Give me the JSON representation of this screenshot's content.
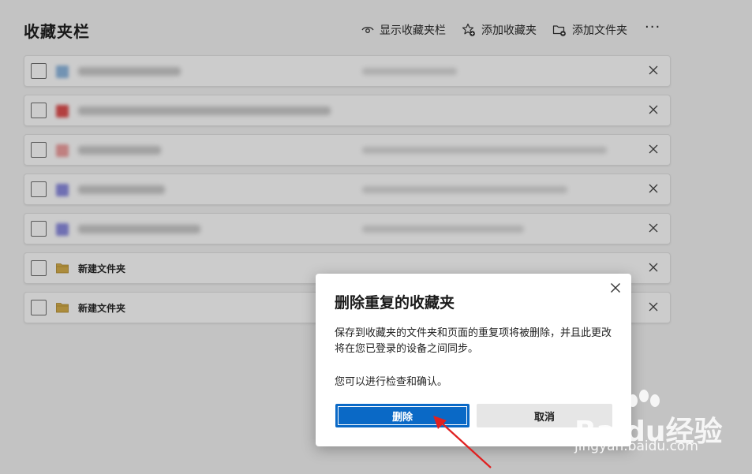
{
  "page": {
    "title": "收藏夹栏",
    "toolbar": {
      "show_bar": "显示收藏夹栏",
      "add_favorite": "添加收藏夹",
      "add_folder": "添加文件夹",
      "more": "···"
    },
    "items": [
      {
        "type": "bookmark",
        "icon_color": "#8fb8e0"
      },
      {
        "type": "bookmark",
        "icon_color": "#e05050"
      },
      {
        "type": "bookmark",
        "icon_color": "#f0a0a0"
      },
      {
        "type": "bookmark",
        "icon_color": "#8c8ce0"
      },
      {
        "type": "bookmark",
        "icon_color": "#8c8ce0"
      },
      {
        "type": "folder",
        "label": "新建文件夹"
      },
      {
        "type": "folder",
        "label": "新建文件夹"
      }
    ]
  },
  "dialog": {
    "title": "删除重复的收藏夹",
    "body": "保存到收藏夹的文件夹和页面的重复项将被删除，并且此更改将在您已登录的设备之间同步。",
    "note": "您可以进行检查和确认。",
    "delete_label": "删除",
    "cancel_label": "取消"
  },
  "watermark": {
    "logo": "Baidu经验",
    "url": "jingyan.baidu.com"
  },
  "colors": {
    "accent": "#0a69c6",
    "arrow": "#e02020",
    "folder": "#d8b04c"
  }
}
